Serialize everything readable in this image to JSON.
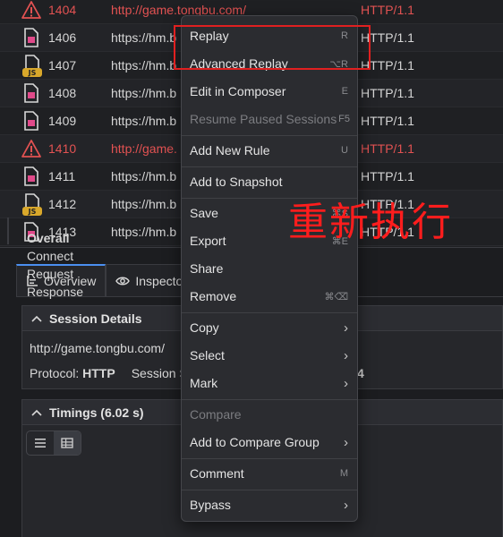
{
  "sessions": [
    {
      "id": "1404",
      "url": "http://game.tongbu.com/",
      "protocol": "HTTP/1.1",
      "icon": "warning-icon",
      "error": true
    },
    {
      "id": "1406",
      "url": "https://hm.b",
      "protocol": "HTTP/1.1",
      "icon": "image-file-icon",
      "error": false
    },
    {
      "id": "1407",
      "url": "https://hm.b",
      "protocol": "HTTP/1.1",
      "icon": "js-file-icon",
      "error": false
    },
    {
      "id": "1408",
      "url": "https://hm.b",
      "protocol": "HTTP/1.1",
      "icon": "image-file-icon",
      "error": false
    },
    {
      "id": "1409",
      "url": "https://hm.b",
      "protocol": "HTTP/1.1",
      "icon": "image-file-icon",
      "error": false
    },
    {
      "id": "1410",
      "url": "http://game.",
      "protocol": "HTTP/1.1",
      "icon": "warning-icon",
      "error": true
    },
    {
      "id": "1411",
      "url": "https://hm.b",
      "protocol": "HTTP/1.1",
      "icon": "image-file-icon",
      "error": false
    },
    {
      "id": "1412",
      "url": "https://hm.b",
      "protocol": "HTTP/1.1",
      "icon": "js-file-icon",
      "error": false
    },
    {
      "id": "1413",
      "url": "https://hm.b",
      "protocol": "HTTP/1.1",
      "icon": "image-file-icon",
      "error": false
    }
  ],
  "tabs": [
    {
      "label": "Overview",
      "icon": "overview-icon",
      "active": true
    },
    {
      "label": "Inspector",
      "icon": "eye-icon",
      "active": false
    }
  ],
  "session_details": {
    "title": "Session Details",
    "url": "http://game.tongbu.com/",
    "protocol_label": "Protocol:",
    "protocol_value": "HTTP",
    "session_label": "Session S",
    "trailing": "4"
  },
  "timings": {
    "title": "Timings (6.02 s)",
    "rows": [
      "Overall",
      "Connect",
      "Request",
      "Response"
    ]
  },
  "menu": {
    "items": [
      {
        "label": "Replay",
        "shortcut": "R"
      },
      {
        "label": "Advanced Replay",
        "shortcut": "⌥R"
      },
      {
        "label": "Edit in Composer",
        "shortcut": "E"
      },
      {
        "label": "Resume Paused Sessions",
        "shortcut": "F5",
        "disabled": true
      },
      {
        "label": "Add New Rule",
        "shortcut": "U"
      },
      {
        "label": "Add to Snapshot",
        "shortcut": ""
      },
      {
        "label": "Save",
        "shortcut": "⌘S"
      },
      {
        "label": "Export",
        "shortcut": "⌘E"
      },
      {
        "label": "Share",
        "shortcut": ""
      },
      {
        "label": "Remove",
        "shortcut": "⌘⌫"
      },
      {
        "label": "Copy",
        "submenu": true
      },
      {
        "label": "Select",
        "submenu": true
      },
      {
        "label": "Mark",
        "submenu": true
      },
      {
        "label": "Compare",
        "disabled": true
      },
      {
        "label": "Add to Compare Group",
        "submenu": true
      },
      {
        "label": "Comment",
        "shortcut": "M"
      },
      {
        "label": "Bypass",
        "submenu": true
      }
    ]
  },
  "annotation": "重新执行",
  "colors": {
    "error": "#e25252",
    "accent": "#4b8ff0",
    "highlight": "#e02020"
  }
}
